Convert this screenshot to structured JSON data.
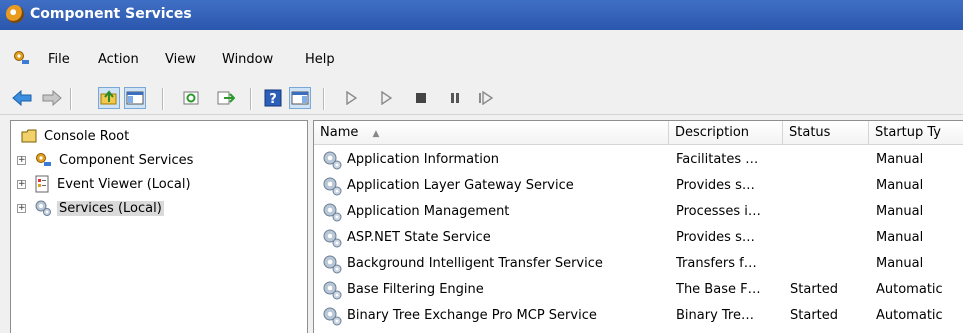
{
  "window": {
    "title": "Component Services"
  },
  "menu": [
    "File",
    "Action",
    "View",
    "Window",
    "Help"
  ],
  "toolbar": {
    "buttons": [
      "back",
      "forward",
      "up-folder",
      "show-hide-tree",
      "refresh",
      "export",
      "help",
      "properties-view",
      "start",
      "start-alt",
      "stop",
      "pause",
      "resume"
    ]
  },
  "tree": {
    "root": "Console Root",
    "items": [
      {
        "label": "Component Services",
        "icon": "component-services-icon",
        "expander": "+"
      },
      {
        "label": "Event Viewer (Local)",
        "icon": "event-viewer-icon",
        "expander": "+"
      },
      {
        "label": "Services (Local)",
        "icon": "services-icon",
        "expander": "+",
        "selected": true
      }
    ]
  },
  "columns": [
    "Name",
    "Description",
    "Status",
    "Startup Ty"
  ],
  "sort_indicator": "▲",
  "services": [
    {
      "name": "Application Information",
      "description": "Facilitates …",
      "status": "",
      "startup": "Manual"
    },
    {
      "name": "Application Layer Gateway Service",
      "description": "Provides s…",
      "status": "",
      "startup": "Manual"
    },
    {
      "name": "Application Management",
      "description": "Processes i…",
      "status": "",
      "startup": "Manual"
    },
    {
      "name": "ASP.NET State Service",
      "description": "Provides s…",
      "status": "",
      "startup": "Manual"
    },
    {
      "name": "Background Intelligent Transfer Service",
      "description": "Transfers f…",
      "status": "",
      "startup": "Manual"
    },
    {
      "name": "Base Filtering Engine",
      "description": "The Base F…",
      "status": "Started",
      "startup": "Automatic"
    },
    {
      "name": "Binary Tree Exchange Pro MCP Service",
      "description": "Binary Tre…",
      "status": "Started",
      "startup": "Automatic"
    }
  ],
  "colors": {
    "title_bar": "#2b57ad",
    "selection": "#dadada",
    "border": "#8e8e8e"
  }
}
